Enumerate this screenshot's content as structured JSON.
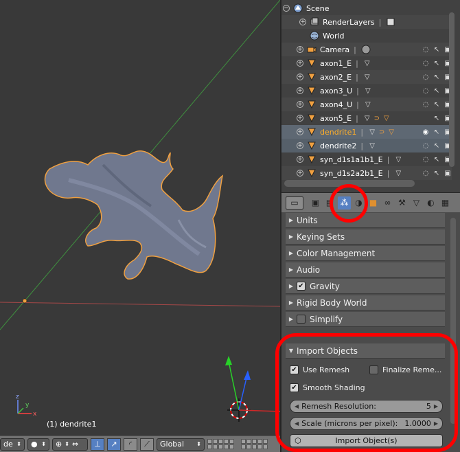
{
  "viewport": {
    "object_label": "(1) dendrite1",
    "header": {
      "mode_select": "de",
      "orientation_select": "Global",
      "mode_arrows": "⬍"
    }
  },
  "outliner": {
    "rows": [
      {
        "name": "Scene",
        "icon": "scene-icon"
      },
      {
        "name": "RenderLayers",
        "icon": "renderlayers-icon"
      },
      {
        "name": "World",
        "icon": "world-icon"
      },
      {
        "name": "Camera",
        "icon": "camera-icon"
      },
      {
        "name": "axon1_E",
        "icon": "mesh-icon"
      },
      {
        "name": "axon2_E",
        "icon": "mesh-icon"
      },
      {
        "name": "axon3_U",
        "icon": "mesh-icon"
      },
      {
        "name": "axon4_U",
        "icon": "mesh-icon"
      },
      {
        "name": "axon5_E",
        "icon": "mesh-icon"
      },
      {
        "name": "dendrite1",
        "icon": "mesh-icon"
      },
      {
        "name": "dendrite2",
        "icon": "mesh-icon"
      },
      {
        "name": "syn_d1s1a1b1_E",
        "icon": "mesh-icon"
      },
      {
        "name": "syn_d1s2a2b1_E",
        "icon": "mesh-icon"
      }
    ]
  },
  "properties": {
    "active_tab": "scene",
    "panels": [
      {
        "label": "Units",
        "checkbox": null
      },
      {
        "label": "Keying Sets",
        "checkbox": null
      },
      {
        "label": "Color Management",
        "checkbox": null
      },
      {
        "label": "Audio",
        "checkbox": null
      },
      {
        "label": "Gravity",
        "checkbox": true
      },
      {
        "label": "Rigid Body World",
        "checkbox": null
      },
      {
        "label": "Simplify",
        "checkbox": false
      }
    ],
    "import_objects": {
      "title": "Import Objects",
      "use_remesh": {
        "label": "Use Remesh",
        "checked": true
      },
      "finalize_remesh": {
        "label": "Finalize Reme...",
        "checked": false
      },
      "smooth_shading": {
        "label": "Smooth Shading",
        "checked": true
      },
      "remesh_resolution": {
        "label": "Remesh Resolution:",
        "value": "5"
      },
      "scale": {
        "label": "Scale (microns per pixel):",
        "value": "1.0000"
      },
      "import_button": "Import Object(s)"
    }
  },
  "annotation_color": "#ff0000"
}
